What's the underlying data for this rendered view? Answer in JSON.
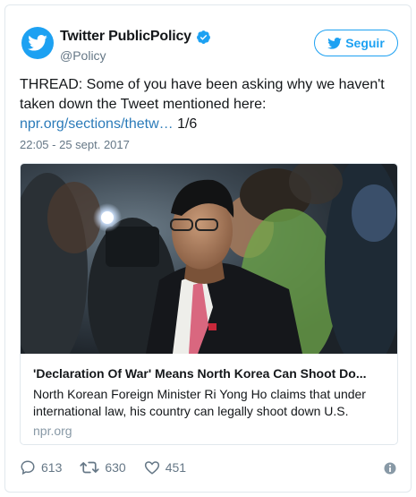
{
  "author": {
    "name": "Twitter PublicPolicy",
    "handle": "@Policy",
    "avatar_icon": "twitter-bird-icon",
    "verified_icon": "verified-badge-icon"
  },
  "follow_button": {
    "label": "Seguir",
    "icon": "twitter-bird-icon"
  },
  "tweet": {
    "text_before_link": "THREAD: Some of you have been asking why we haven't taken down the Tweet mentioned here:",
    "link_text": "npr.org/sections/thetw…",
    "text_after_link": " 1/6",
    "timestamp": "22:05 - 25 sept. 2017"
  },
  "card": {
    "title": "'Declaration Of War' Means North Korea Can Shoot Do...",
    "description": "North Korean Foreign Minister Ri Yong Ho claims that under international law, his country can legally shoot down U.S.",
    "domain": "npr.org"
  },
  "actions": {
    "replies": "613",
    "retweets": "630",
    "likes": "451",
    "reply_icon": "reply-icon",
    "retweet_icon": "retweet-icon",
    "like_icon": "heart-icon",
    "info_icon": "info-icon"
  },
  "colors": {
    "brand": "#1da1f2",
    "link": "#2b7bb9",
    "muted": "#657786"
  }
}
